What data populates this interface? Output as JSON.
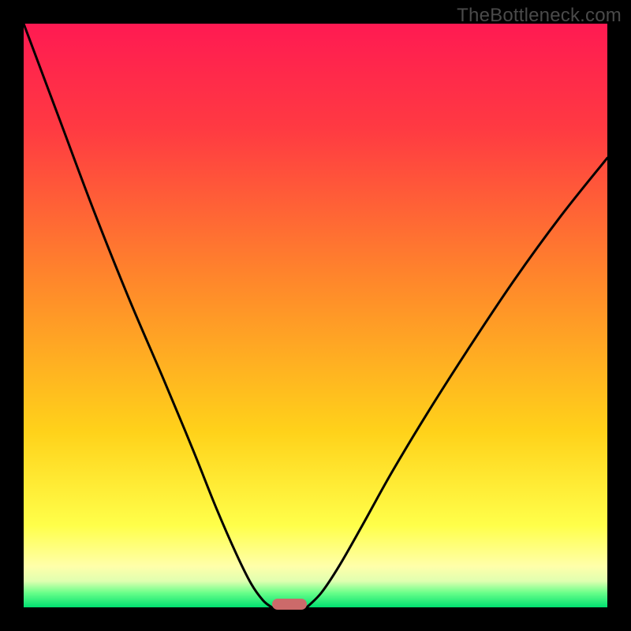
{
  "domain": "Chart",
  "watermark": "TheBottleneck.com",
  "chart_data": {
    "type": "line",
    "title": "",
    "xlabel": "",
    "ylabel": "",
    "xlim": [
      0,
      100
    ],
    "ylim": [
      0,
      100
    ],
    "axes_visible": false,
    "grid": false,
    "background_gradient_stops": [
      {
        "pos": 0,
        "color": "#ff1a52"
      },
      {
        "pos": 18,
        "color": "#ff3a42"
      },
      {
        "pos": 45,
        "color": "#ff8a2a"
      },
      {
        "pos": 70,
        "color": "#ffd21a"
      },
      {
        "pos": 86,
        "color": "#ffff4a"
      },
      {
        "pos": 93,
        "color": "#ffffaa"
      },
      {
        "pos": 95.5,
        "color": "#e0ffb0"
      },
      {
        "pos": 97.5,
        "color": "#6aff8a"
      },
      {
        "pos": 100,
        "color": "#00e070"
      }
    ],
    "series": [
      {
        "name": "left-curve",
        "x": [
          0,
          6,
          12,
          18,
          24,
          29,
          33,
          36.5,
          39,
          41,
          42.5
        ],
        "y": [
          100,
          84,
          68,
          53,
          39,
          27,
          17,
          9,
          4,
          1.2,
          0
        ]
      },
      {
        "name": "right-curve",
        "x": [
          48.5,
          51,
          54,
          58,
          63,
          69,
          76,
          84,
          92,
          100
        ],
        "y": [
          0,
          2.5,
          7,
          14,
          23,
          33,
          44,
          56,
          67,
          77
        ]
      }
    ],
    "marker": {
      "name": "bottleneck-marker",
      "x": 45.5,
      "y": 0.5,
      "color": "#cc6a6a",
      "shape": "rounded-bar"
    },
    "notes": "Values are read from pixel positions relative to a 0–100 axis; no numeric tick labels are present in the original image."
  }
}
